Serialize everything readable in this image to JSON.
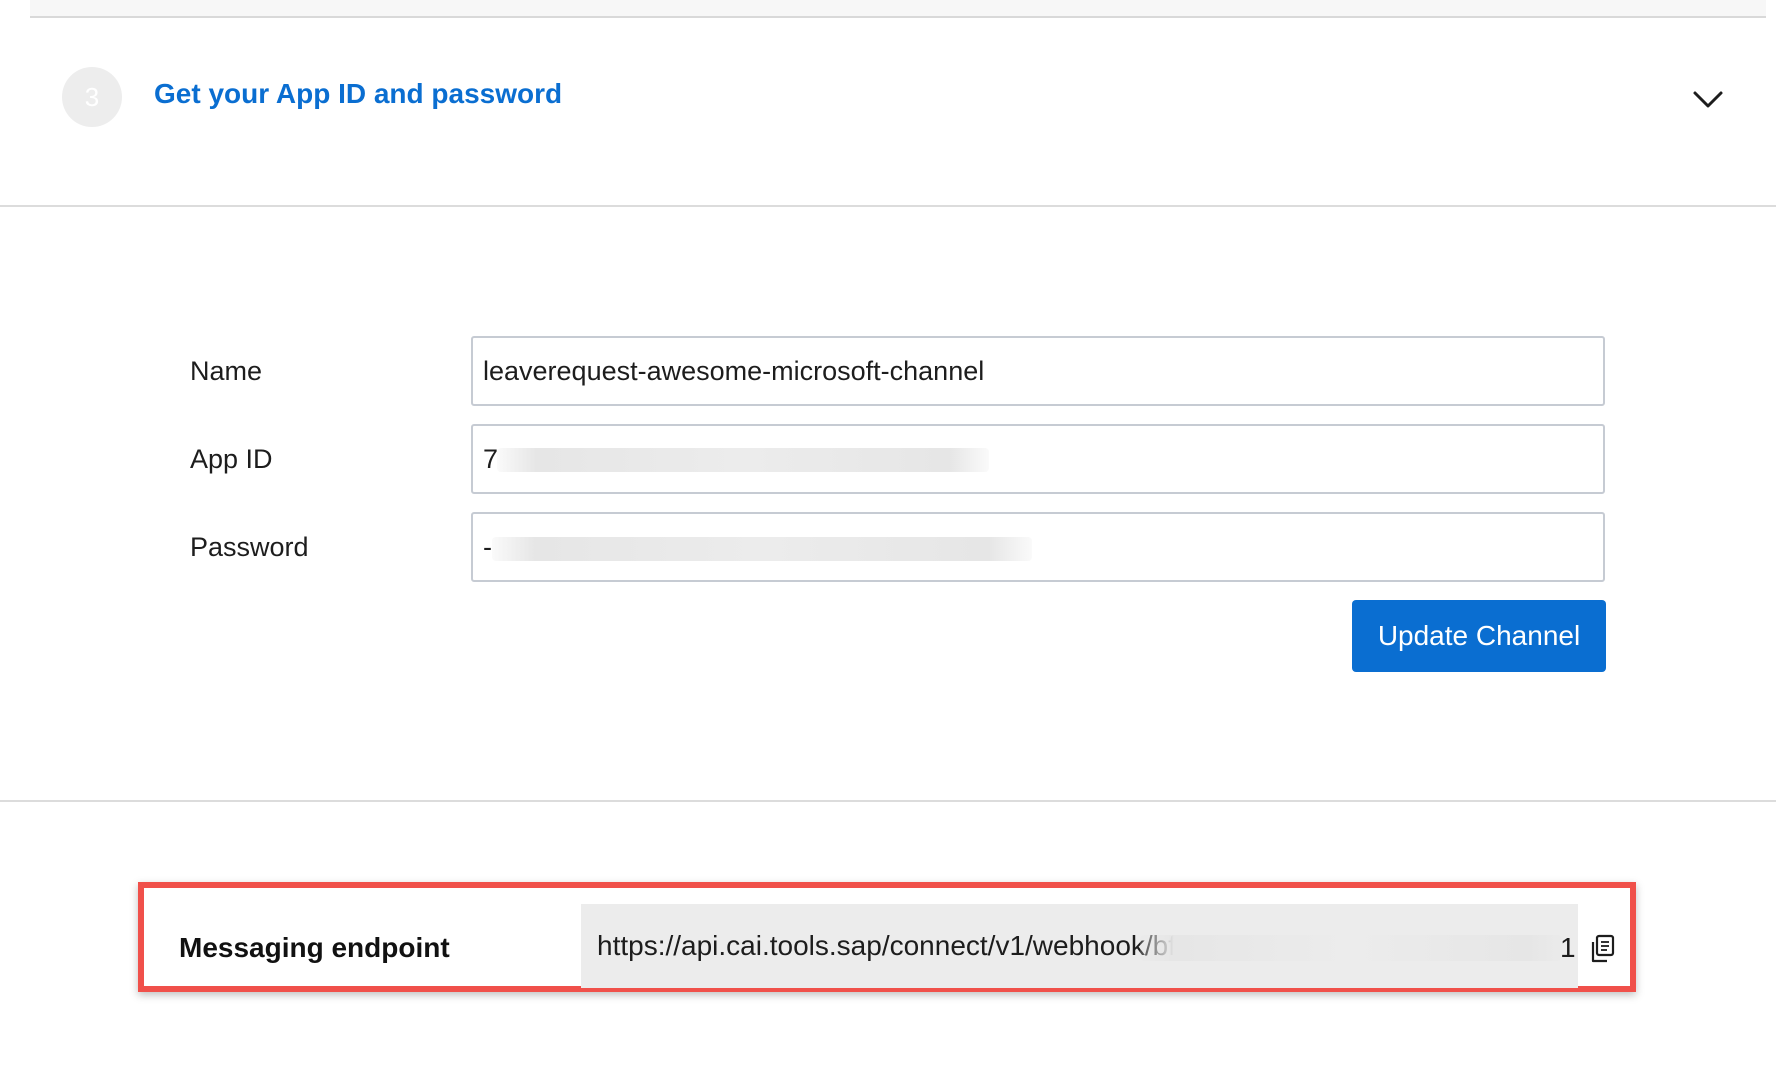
{
  "step": {
    "number": "3",
    "title": "Get your App ID and password",
    "expand_icon": "chevron-down-icon"
  },
  "form": {
    "name_label": "Name",
    "name_value": "leaverequest-awesome-microsoft-channel",
    "appid_label": "App ID",
    "appid_value": "7",
    "password_label": "Password",
    "password_value": "-",
    "update_button": "Update Channel"
  },
  "endpoint": {
    "label": "Messaging endpoint",
    "url": "https://api.cai.tools.sap/connect/v1/webhook/bf",
    "url_tail": "1",
    "copy_icon": "copy-icon",
    "highlight_color": "#f0504a"
  },
  "colors": {
    "accent": "#0a6ed1",
    "step_circle": "#ededed"
  }
}
